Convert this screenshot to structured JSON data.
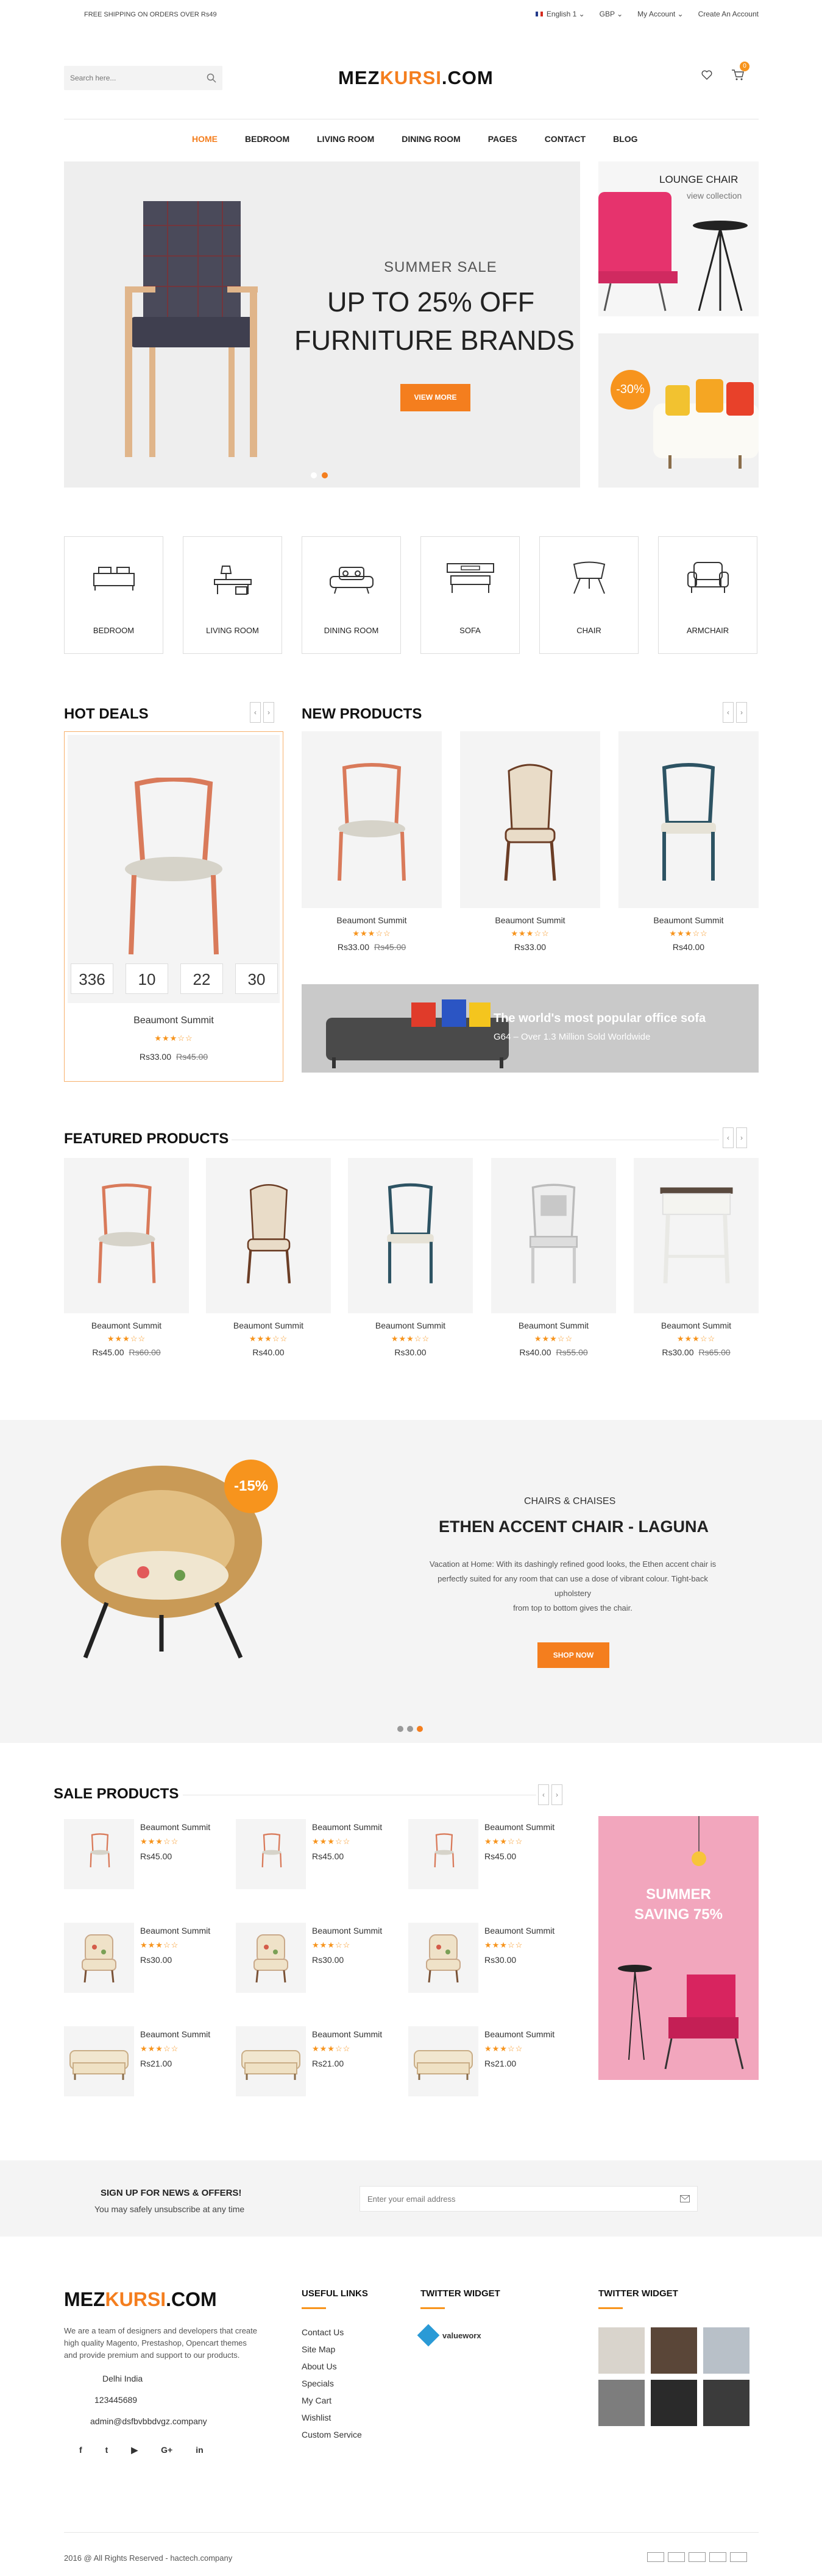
{
  "topbar": {
    "shipping": "FREE SHIPPING ON ORDERS OVER Rs49",
    "language": "English 1",
    "currency": "GBP",
    "account": "My Account",
    "create": "Create An Account"
  },
  "header": {
    "search_placeholder": "Search here...",
    "logo_a": "MEZ",
    "logo_b": "KURSI",
    "logo_c": ".COM",
    "cart_count": "0"
  },
  "nav": [
    "HOME",
    "BEDROOM",
    "LIVING ROOM",
    "DINING ROOM",
    "PAGES",
    "CONTACT",
    "BLOG"
  ],
  "slider": {
    "kicker": "SUMMER SALE",
    "line1": "UP TO 25% OFF",
    "line2": "FURNITURE BRANDS",
    "button": "VIEW MORE"
  },
  "promo1": {
    "title": "LOUNGE CHAIR",
    "sub": "view collection"
  },
  "promo2": {
    "badge": "-30%"
  },
  "categories": [
    "BEDROOM",
    "LIVING ROOM",
    "DINING ROOM",
    "SOFA",
    "CHAIR",
    "ARMCHAIR"
  ],
  "hot_deals": {
    "title": "HOT DEALS",
    "countdown": [
      "336",
      "10",
      "22",
      "30"
    ],
    "name": "Beaumont Summit",
    "price": "Rs33.00",
    "old": "Rs45.00"
  },
  "new_products": {
    "title": "NEW PRODUCTS",
    "items": [
      {
        "name": "Beaumont Summit",
        "price": "Rs33.00",
        "old": "Rs45.00"
      },
      {
        "name": "Beaumont Summit",
        "price": "Rs33.00",
        "old": ""
      },
      {
        "name": "Beaumont Summit",
        "price": "Rs40.00",
        "old": ""
      }
    ],
    "banner_title": "The world's most popular office sofa",
    "banner_sub": "G64 – Over 1.3 Million Sold Worldwide"
  },
  "featured": {
    "title": "FEATURED PRODUCTS",
    "items": [
      {
        "name": "Beaumont Summit",
        "price": "Rs45.00",
        "old": "Rs60.00"
      },
      {
        "name": "Beaumont Summit",
        "price": "Rs40.00",
        "old": ""
      },
      {
        "name": "Beaumont Summit",
        "price": "Rs30.00",
        "old": ""
      },
      {
        "name": "Beaumont Summit",
        "price": "Rs40.00",
        "old": "Rs55.00"
      },
      {
        "name": "Beaumont Summit",
        "price": "Rs30.00",
        "old": "Rs65.00"
      }
    ]
  },
  "promo_band": {
    "badge": "-15%",
    "kicker": "CHAIRS & CHAISES",
    "title": "ETHEN ACCENT CHAIR - LAGUNA",
    "desc1": "Vacation at Home: With its dashingly refined good looks, the Ethen accent chair is",
    "desc2": "perfectly suited for any room that can use a dose of vibrant colour. Tight-back",
    "desc3": "upholstery",
    "desc4": "from top to bottom gives the chair.",
    "button": "SHOP NOW"
  },
  "sale": {
    "title": "SALE PRODUCTS",
    "items": [
      {
        "name": "Beaumont Summit",
        "price": "Rs45.00"
      },
      {
        "name": "Beaumont Summit",
        "price": "Rs45.00"
      },
      {
        "name": "Beaumont Summit",
        "price": "Rs45.00"
      },
      {
        "name": "Beaumont Summit",
        "price": "Rs30.00"
      },
      {
        "name": "Beaumont Summit",
        "price": "Rs30.00"
      },
      {
        "name": "Beaumont Summit",
        "price": "Rs30.00"
      },
      {
        "name": "Beaumont Summit",
        "price": "Rs21.00"
      },
      {
        "name": "Beaumont Summit",
        "price": "Rs21.00"
      },
      {
        "name": "Beaumont Summit",
        "price": "Rs21.00"
      }
    ],
    "banner_l1": "SUMMER",
    "banner_l2": "SAVING 75%"
  },
  "newsletter": {
    "title": "SIGN UP FOR NEWS & OFFERS!",
    "sub": "You may safely unsubscribe at any time",
    "placeholder": "Enter your email address"
  },
  "footer": {
    "about": [
      "We are a team of designers and developers that create",
      "high quality Magento, Prestashop, Opencart themes",
      "and provide premium and support to our products."
    ],
    "city": "Delhi India",
    "phone": "123445689",
    "email": "admin@dsfbvbbdvgz.company",
    "useful_title": "USEFUL LINKS",
    "links": [
      "Contact Us",
      "Site Map",
      "About Us",
      "Specials",
      "My Cart",
      "Wishlist",
      "Custom Service"
    ],
    "tw1_title": "TWITTER WIDGET",
    "tw1_user": "valueworx",
    "tw2_title": "TWITTER WIDGET",
    "copyright": "2016 @ All Rights Reserved - hactech.company"
  },
  "colors": {
    "accent": "#f47e1e"
  }
}
